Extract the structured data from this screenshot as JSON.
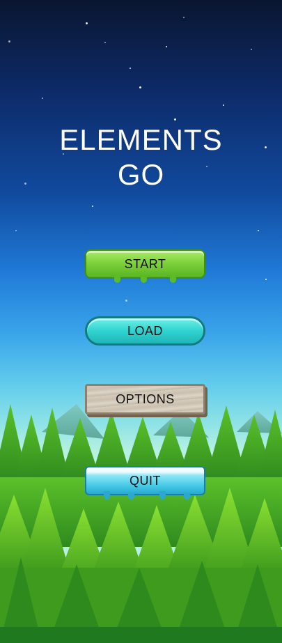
{
  "title": {
    "line1": "ELEMENTS",
    "line2": "GO"
  },
  "menu": {
    "start_label": "START",
    "load_label": "LOAD",
    "options_label": "OPTIONS",
    "quit_label": "QUIT"
  },
  "colors": {
    "sky_top": "#0a1630",
    "sky_bottom": "#b5f0e2",
    "start": "#7fd23c",
    "load": "#2fd3cf",
    "options": "#d6cdbf",
    "quit": "#43c8e6",
    "forest_light": "#6fd22a",
    "forest_dark": "#1f7a1f"
  }
}
